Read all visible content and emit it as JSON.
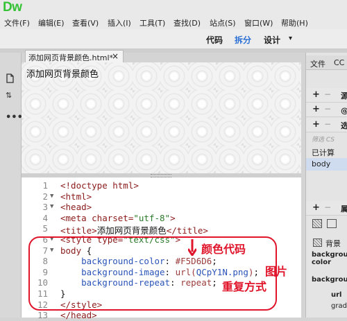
{
  "app": {
    "logo": "Dw"
  },
  "menu": [
    "文件(F)",
    "编辑(E)",
    "查看(V)",
    "插入(I)",
    "工具(T)",
    "查找(D)",
    "站点(S)",
    "窗口(W)",
    "帮助(H)"
  ],
  "view_buttons": {
    "code": "代码",
    "split": "拆分",
    "design": "设计",
    "dropdown_caret": "▾"
  },
  "document": {
    "tab_title": "添加网页背景颜色.html*",
    "tab_close": "×",
    "design_heading": "添加网页背景颜色"
  },
  "code_lines": [
    {
      "n": "1",
      "fold": "",
      "html": "<span class=\"tag\">&lt;!doctype html&gt;</span>"
    },
    {
      "n": "2",
      "fold": "▼",
      "html": "<span class=\"tag\">&lt;html&gt;</span>"
    },
    {
      "n": "3",
      "fold": "▼",
      "html": "<span class=\"tag\">&lt;head&gt;</span>"
    },
    {
      "n": "4",
      "fold": "",
      "html": "<span class=\"tag\">&lt;meta </span><span class=\"attr\">charset=</span><span class=\"str\">\"utf-8\"</span><span class=\"tag\">&gt;</span>"
    },
    {
      "n": "5",
      "fold": "",
      "html": "<span class=\"tag\">&lt;title&gt;</span><span class=\"txt\">添加网页背景颜色</span><span class=\"tag\">&lt;/title&gt;</span>"
    },
    {
      "n": "6",
      "fold": "▼",
      "html": "<span class=\"tag\">&lt;style </span><span class=\"attr\">type=</span><span class=\"str\">\"text/css\"</span><span class=\"tag\">&gt;</span>"
    },
    {
      "n": "7",
      "fold": "▼",
      "html": "<span class=\"tag\">body </span><span class=\"txt\">{</span>"
    },
    {
      "n": "8",
      "fold": "",
      "html": "    <span class=\"prop\">background-color</span><span class=\"txt\">: </span><span class=\"val\">#F5D6D6</span><span class=\"txt\">;</span>"
    },
    {
      "n": "9",
      "fold": "",
      "html": "    <span class=\"prop\">background-image</span><span class=\"txt\">: </span><span class=\"val\">url(</span><span class=\"prop\">QCpY1N.png</span><span class=\"val\">)</span><span class=\"txt\">;</span>"
    },
    {
      "n": "10",
      "fold": "",
      "html": "    <span class=\"prop\">background-repeat</span><span class=\"txt\">: </span><span class=\"val\">repeat</span><span class=\"txt\">;</span>"
    },
    {
      "n": "11",
      "fold": "",
      "html": "<span class=\"txt\">}</span>"
    },
    {
      "n": "12",
      "fold": "",
      "html": "<span class=\"tag\">&lt;/style&gt;</span>"
    },
    {
      "n": "13",
      "fold": "",
      "html": "<span class=\"tag\">&lt;/head&gt;</span>"
    }
  ],
  "annotations": {
    "color_code": "颜色代码",
    "image": "图片",
    "repeat_mode": "重复方式"
  },
  "right_panel": {
    "tabs": [
      "文件",
      "CC"
    ],
    "sections": [
      {
        "plus": "+",
        "minus": "−",
        "label": "源"
      },
      {
        "plus": "+",
        "minus": "−",
        "label": "@媒"
      },
      {
        "plus": "+",
        "minus": "−",
        "label": "选"
      }
    ],
    "filter_placeholder": "筛选 CS",
    "computed_label": "已计算",
    "selected_item": "body",
    "props_section": {
      "plus": "+",
      "minus": "−",
      "label": "属"
    },
    "background_title": "背景",
    "bg_color_label": "background-color",
    "background_label": "background",
    "url_label": "url",
    "grad_label": "grad"
  },
  "colors": {
    "accent": "#2a6fd6",
    "annotation": "#e0142a",
    "logo": "#35c235"
  }
}
